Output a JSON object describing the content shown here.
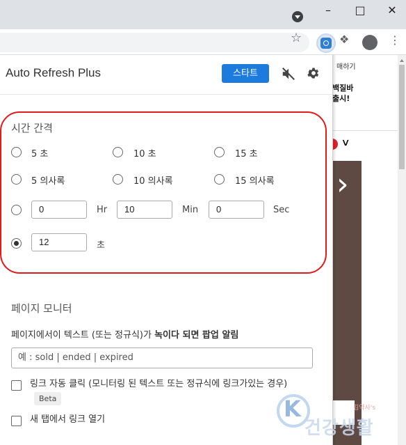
{
  "popup": {
    "title": "Auto Refresh Plus",
    "start_label": "스타트",
    "interval": {
      "title": "시간 간격",
      "presets": [
        {
          "label": "5 초",
          "checked": false
        },
        {
          "label": "10 초",
          "checked": false
        },
        {
          "label": "15 초",
          "checked": false
        },
        {
          "label": "5 의사록",
          "checked": false
        },
        {
          "label": "10 의사록",
          "checked": false
        },
        {
          "label": "15 의사록",
          "checked": false
        }
      ],
      "custom_time": {
        "hr_value": "0",
        "hr_label": "Hr",
        "min_value": "10",
        "min_label": "Min",
        "sec_value": "0",
        "sec_label": "Sec",
        "checked": false
      },
      "custom_seconds": {
        "value": "12",
        "unit": "초",
        "checked": true
      }
    },
    "monitor": {
      "title": "페이지 모니터",
      "desc_pre": "페이지에서이 텍스트 (또는 정규식)가 ",
      "desc_bold": "녹이다 되면 팝업 알림",
      "pattern_placeholder": "예 : sold | ended | expired",
      "autoclick_label": "링크 자동 클릭 (모니터링 된 텍스트 또는 정규식에 링크가있는 경우)",
      "beta_label": "Beta",
      "newtab_label": "새 탭에서 링크 열기"
    }
  },
  "background_page": {
    "top_text": "매하기",
    "promo_line1": "백질바",
    "promo_line2": "출시!"
  },
  "watermark": {
    "text": "건강생활",
    "small": "김약사's"
  },
  "colors": {
    "accent": "#1e7bde",
    "highlight_outline": "#e11b1b"
  }
}
